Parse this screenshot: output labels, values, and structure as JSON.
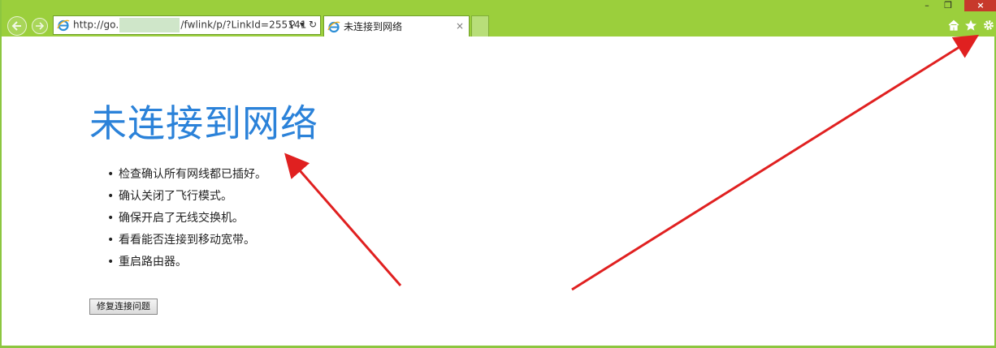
{
  "browser": {
    "address": {
      "url_prefix": "http://go.",
      "url_suffix": "/fwlink/p/?LinkId=255141",
      "search_glyph": "⚲",
      "dropdown_glyph": "▾",
      "refresh_glyph": "↻"
    },
    "tab": {
      "title": "未连接到网络",
      "close_glyph": "×"
    },
    "window_controls": {
      "minimize": "–",
      "maximize": "❐",
      "close": "×"
    },
    "icons": [
      "back-arrow-icon",
      "forward-arrow-icon",
      "ie-logo-icon",
      "home-icon",
      "star-icon",
      "gear-icon"
    ]
  },
  "page": {
    "title": "未连接到网络",
    "tips": [
      "检查确认所有网线都已插好。",
      "确认关闭了飞行模式。",
      "确保开启了无线交换机。",
      "看看能否连接到移动宽带。",
      "重启路由器。"
    ],
    "repair_button": "修复连接问题"
  },
  "colors": {
    "chrome_green": "#9bcf3c",
    "title_blue": "#2b82d9",
    "annotation_red": "#e02020",
    "close_red": "#c7392b"
  }
}
